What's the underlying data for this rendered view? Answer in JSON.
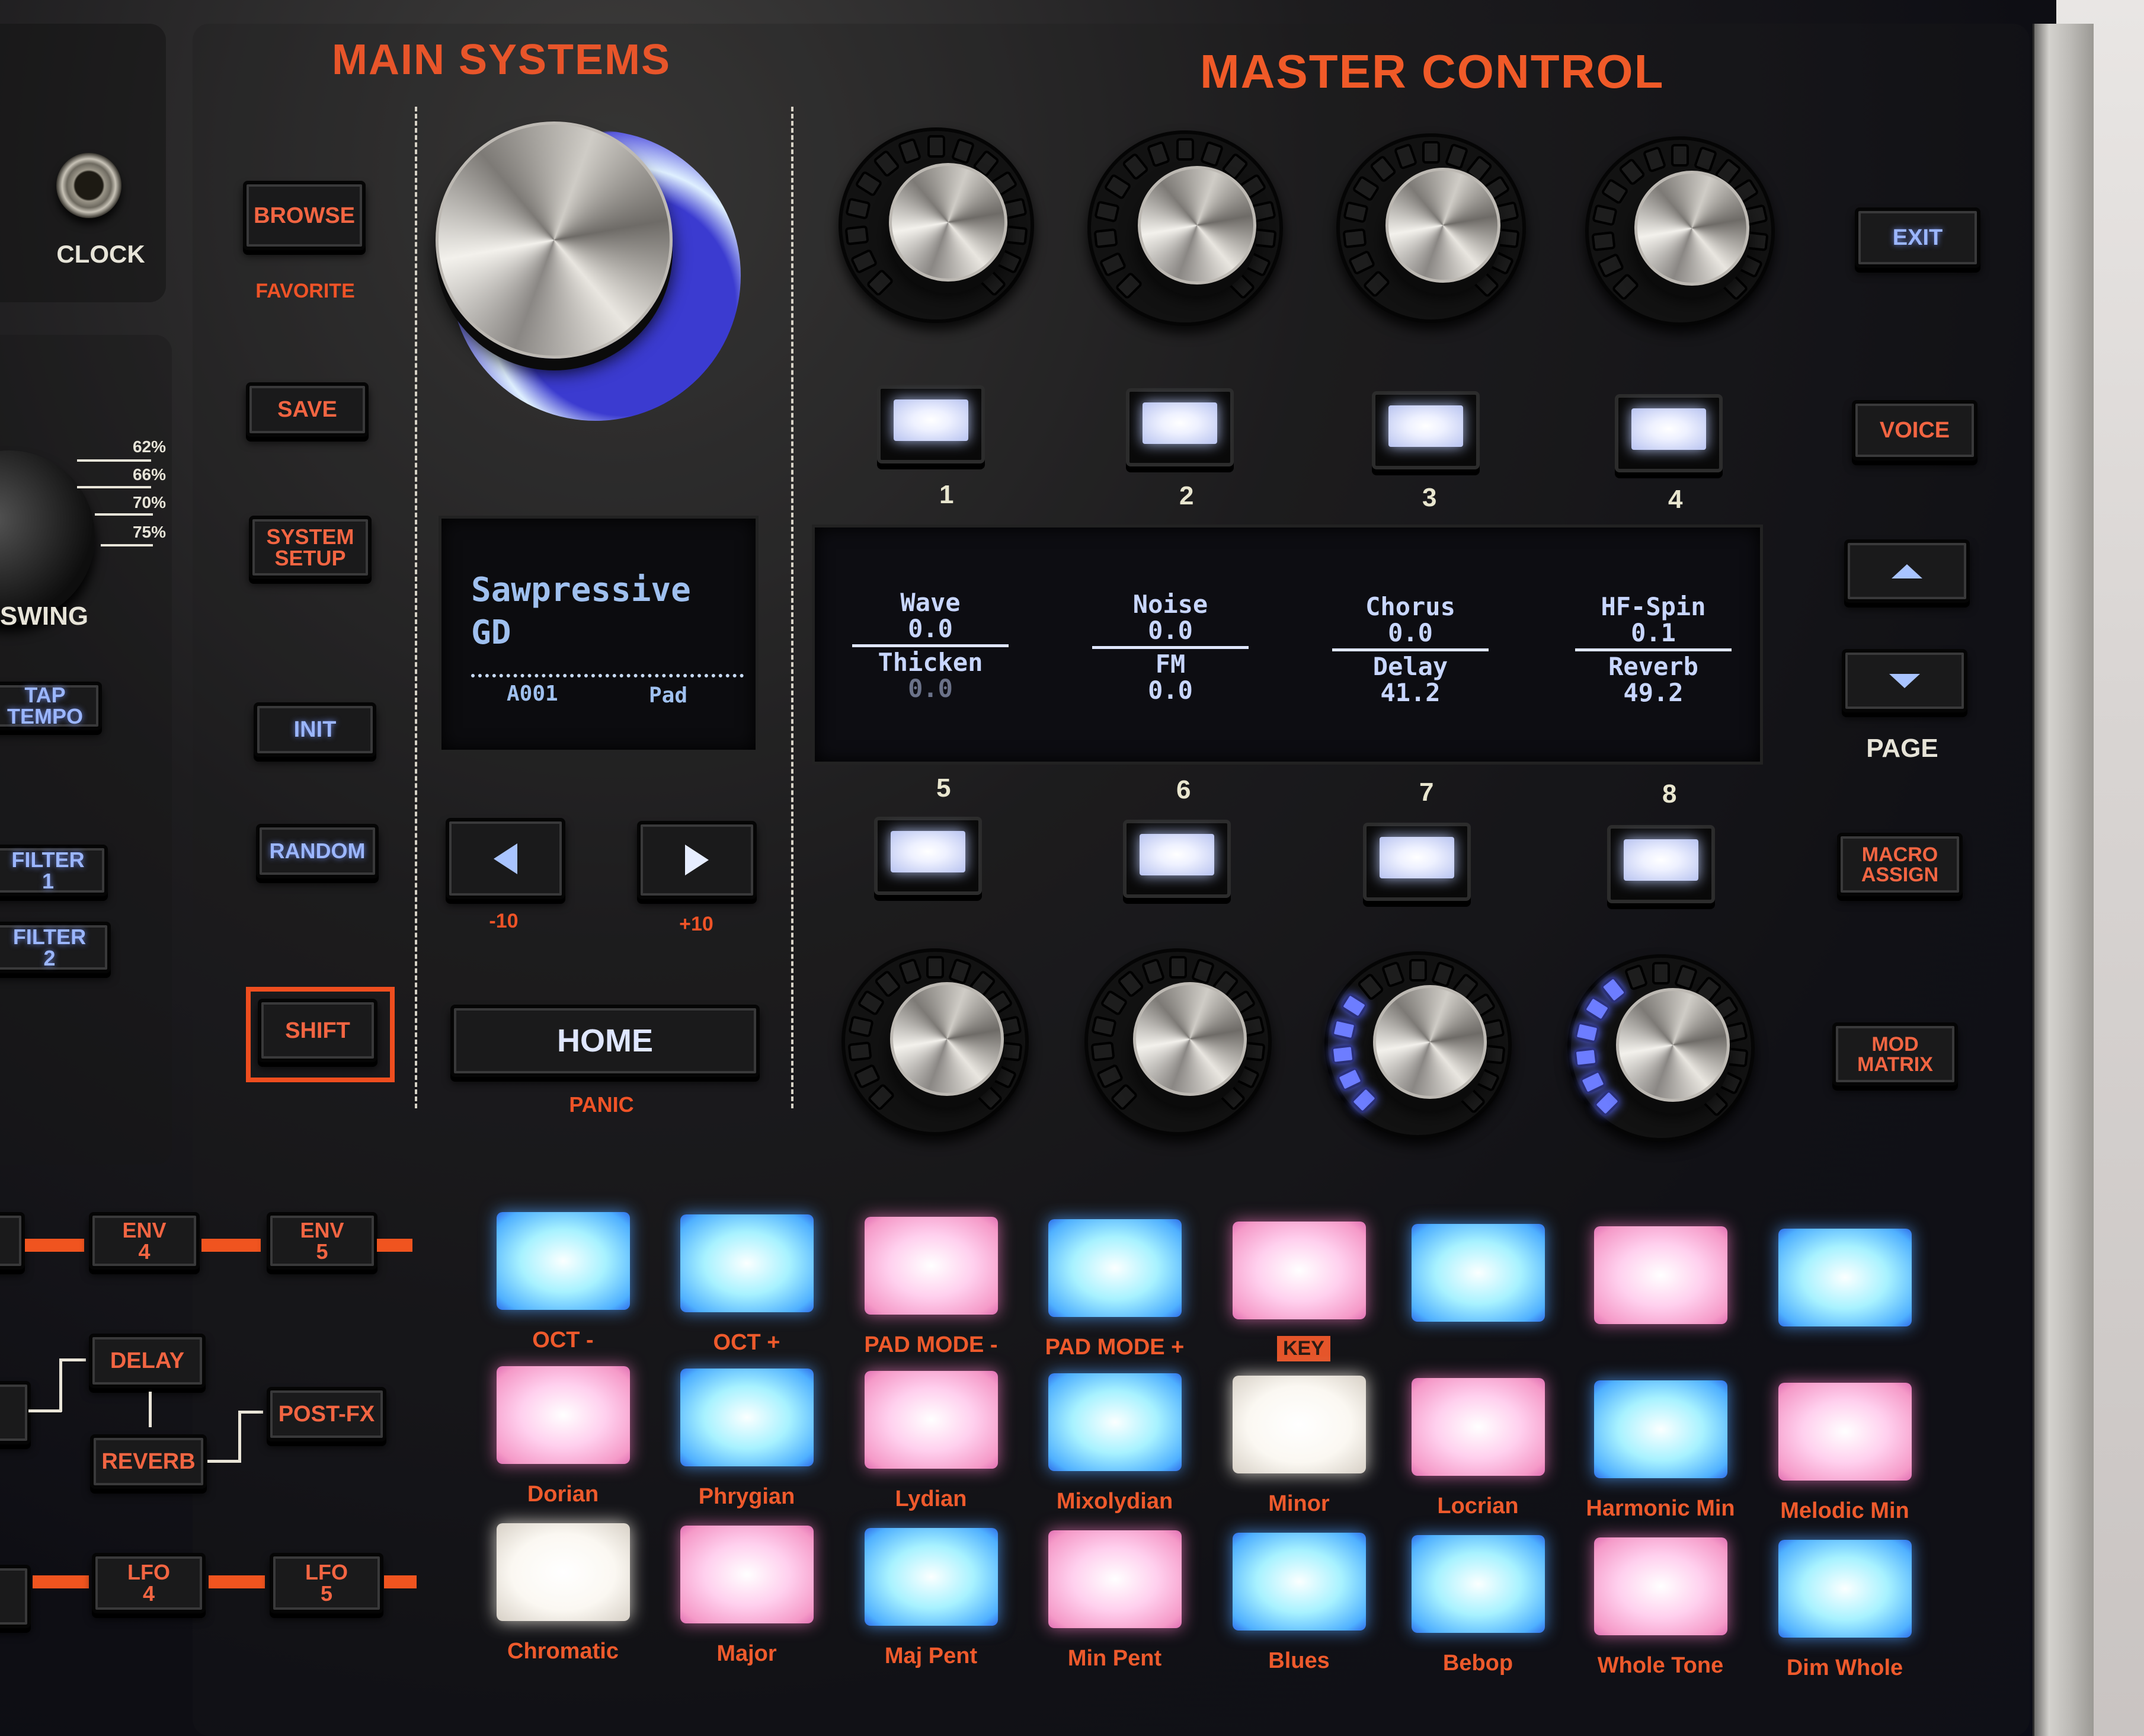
{
  "device": {
    "brand_label": "MAIN SYSTEMS",
    "section_title": "MASTER CONTROL"
  },
  "left_strip": {
    "clock_label": "CLOCK",
    "swing": {
      "label": "SWING",
      "scale": [
        "62%",
        "66%",
        "70%",
        "75%"
      ]
    },
    "tap_tempo": "TAP\nTEMPO",
    "filter1": "FILTER\n1",
    "filter2": "FILTER\n2",
    "env4": "ENV\n4",
    "env5": "ENV\n5",
    "delay": "DELAY",
    "reverb": "REVERB",
    "post_fx": "POST-FX",
    "lfo4": "LFO\n4",
    "lfo5": "LFO\n5"
  },
  "system_buttons": {
    "browse": "BROWSE",
    "favorite": "FAVORITE",
    "save": "SAVE",
    "system_setup": "SYSTEM\nSETUP",
    "init": "INIT",
    "random": "RANDOM",
    "shift": "SHIFT"
  },
  "patch_display": {
    "patch_name_line1": "Sawpressive",
    "patch_name_line2": "GD",
    "bank_slot": "A001",
    "category": "Pad"
  },
  "navigation": {
    "prev_icon": "left-triangle",
    "next_icon": "right-triangle",
    "prev_shift_label": "-10",
    "next_shift_label": "+10",
    "home": "HOME",
    "panic": "PANIC"
  },
  "macro_display": {
    "columns": [
      {
        "top_name": "Wave",
        "top_value": "0.0",
        "bottom_name": "Thicken",
        "bottom_value": "0.0"
      },
      {
        "top_name": "Noise",
        "top_value": "0.0",
        "bottom_name": "FM",
        "bottom_value": "0.0"
      },
      {
        "top_name": "Chorus",
        "top_value": "0.0",
        "bottom_name": "Delay",
        "bottom_value": "41.2"
      },
      {
        "top_name": "HF-Spin",
        "top_value": "0.1",
        "bottom_name": "Reverb",
        "bottom_value": "49.2"
      }
    ]
  },
  "macro_knobs": {
    "top_numbers": [
      "1",
      "2",
      "3",
      "4"
    ],
    "bottom_numbers": [
      "5",
      "6",
      "7",
      "8"
    ],
    "led_ring_lit_segments": {
      "knob1": 0,
      "knob2": 0,
      "knob3": 0,
      "knob4": 0,
      "knob5": 0,
      "knob6": 0,
      "knob7": 5,
      "knob8": 6
    }
  },
  "right_buttons": {
    "exit": "EXIT",
    "voice": "VOICE",
    "page_up_icon": "up-triangle",
    "page_down_icon": "down-triangle",
    "page_label": "PAGE",
    "macro_assign": "MACRO\nASSIGN",
    "mod_matrix": "MOD\nMATRIX"
  },
  "pads": {
    "row1": [
      {
        "label": "OCT -",
        "color": "cyan"
      },
      {
        "label": "OCT +",
        "color": "cyan"
      },
      {
        "label": "PAD MODE -",
        "color": "pink"
      },
      {
        "label": "PAD MODE +",
        "color": "cyan"
      },
      {
        "label": "KEY",
        "color": "pink",
        "badge": true
      },
      {
        "label": "",
        "color": "cyan"
      },
      {
        "label": "",
        "color": "pink"
      },
      {
        "label": "",
        "color": "cyan"
      }
    ],
    "row2": [
      {
        "label": "Dorian",
        "color": "pink"
      },
      {
        "label": "Phrygian",
        "color": "cyan"
      },
      {
        "label": "Lydian",
        "color": "pink"
      },
      {
        "label": "Mixolydian",
        "color": "cyan"
      },
      {
        "label": "Minor",
        "color": "white"
      },
      {
        "label": "Locrian",
        "color": "pink"
      },
      {
        "label": "Harmonic Min",
        "color": "cyan"
      },
      {
        "label": "Melodic Min",
        "color": "pink"
      }
    ],
    "row3": [
      {
        "label": "Chromatic",
        "color": "white"
      },
      {
        "label": "Major",
        "color": "pink"
      },
      {
        "label": "Maj Pent",
        "color": "cyan"
      },
      {
        "label": "Min Pent",
        "color": "pink"
      },
      {
        "label": "Blues",
        "color": "cyan"
      },
      {
        "label": "Bebop",
        "color": "cyan"
      },
      {
        "label": "Whole Tone",
        "color": "pink"
      },
      {
        "label": "Dim Whole",
        "color": "cyan"
      }
    ],
    "colors": {
      "cyan": "#8fe6ff",
      "pink": "#f7a9d4",
      "white": "#fbf7ef"
    }
  },
  "colors": {
    "panel": "#111116",
    "accent_orange": "#f05a28",
    "oled_text": "#9fc0ef",
    "button_blue_text": "#9bb6ff"
  }
}
